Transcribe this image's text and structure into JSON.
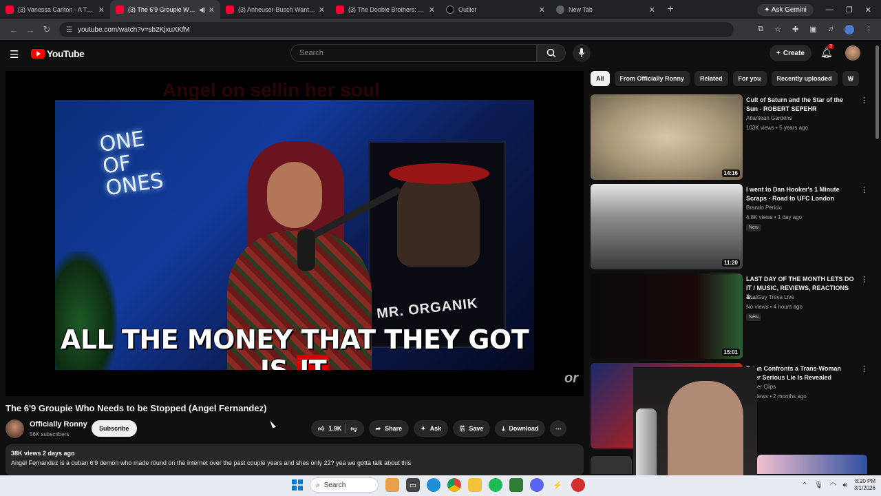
{
  "browser": {
    "tabs": [
      {
        "title": "(3) Vanessa Carlton - A Thousa",
        "active": false,
        "favicon": "youtube-icon"
      },
      {
        "title": "(3) The 6'9 Groupie Who N",
        "active": true,
        "favicon": "youtube-icon"
      },
      {
        "title": "(3) Anheuser-Busch Wanted A",
        "active": false,
        "favicon": "youtube-icon"
      },
      {
        "title": "(3) The Doobie Brothers: Tiny D",
        "active": false,
        "favicon": "youtube-icon"
      },
      {
        "title": "Outlier",
        "active": false,
        "favicon": "outlier-icon"
      },
      {
        "title": "New Tab",
        "active": false,
        "favicon": "newtab-icon"
      }
    ],
    "ask_gemini": "Ask Gemini",
    "url": "youtube.com/watch?v=sb2KjxuXKfM"
  },
  "youtube": {
    "logo_text": "YouTube",
    "search_placeholder": "Search",
    "create_label": "Create",
    "notification_count": "3"
  },
  "player": {
    "ghost_caption": "Angel on sellin her soul",
    "caption_main": "ALL THE MONEY THAT THEY GOT IS ",
    "caption_highlight": "IT",
    "neon_sign": "ONE OF ONES",
    "poster_label": "MR. ORGANIK",
    "watermark": "or"
  },
  "video": {
    "title": "The 6'9 Groupie Who Needs to be Stopped (Angel Fernandez)",
    "channel": "Officially Ronny",
    "subscribers": "56K subscribers",
    "subscribe_label": "Subscribe",
    "likes": "1.9K",
    "share_label": "Share",
    "ask_label": "Ask",
    "save_label": "Save",
    "download_label": "Download",
    "meta": "38K views  2 days ago",
    "description": "Angel Fernandez is a cuban 6'9 demon who made round on the internet over the past couple years and shes only 22? yea we gotta talk about this"
  },
  "chips": [
    "All",
    "From Officially Ronny",
    "Related",
    "For you",
    "Recently uploaded",
    "W"
  ],
  "recommendations": [
    {
      "title": "Cult of Saturn and the Star of the Sun - ROBERT SEPEHR",
      "channel": "Atlantean Gardens",
      "views": "103K views • 5 years ago",
      "duration": "14:16",
      "badge": ""
    },
    {
      "title": "I went to Dan Hooker's 1 Minute Scraps - Road to UFC London",
      "channel": "Brando Pericic",
      "views": "4.8K views • 1 day ago",
      "duration": "11:20",
      "badge": "New"
    },
    {
      "title": "LAST DAY OF THE MONTH LETS DO IT / MUSIC, REVIEWS, REACTIONS &...",
      "channel": "ThatGuy Treva Live",
      "views": "No views • 4 hours ago",
      "duration": "15:01",
      "badge": "New"
    },
    {
      "title": "Brian Confronts a Trans-Woman After Serious Lie Is Revealed",
      "channel": "Clever Clips",
      "views": "6K views • 2 months ago",
      "duration": "",
      "badge": ""
    }
  ],
  "taskbar": {
    "search_label": "Search",
    "time": "8:20 PM",
    "date": "3/1/2026"
  }
}
